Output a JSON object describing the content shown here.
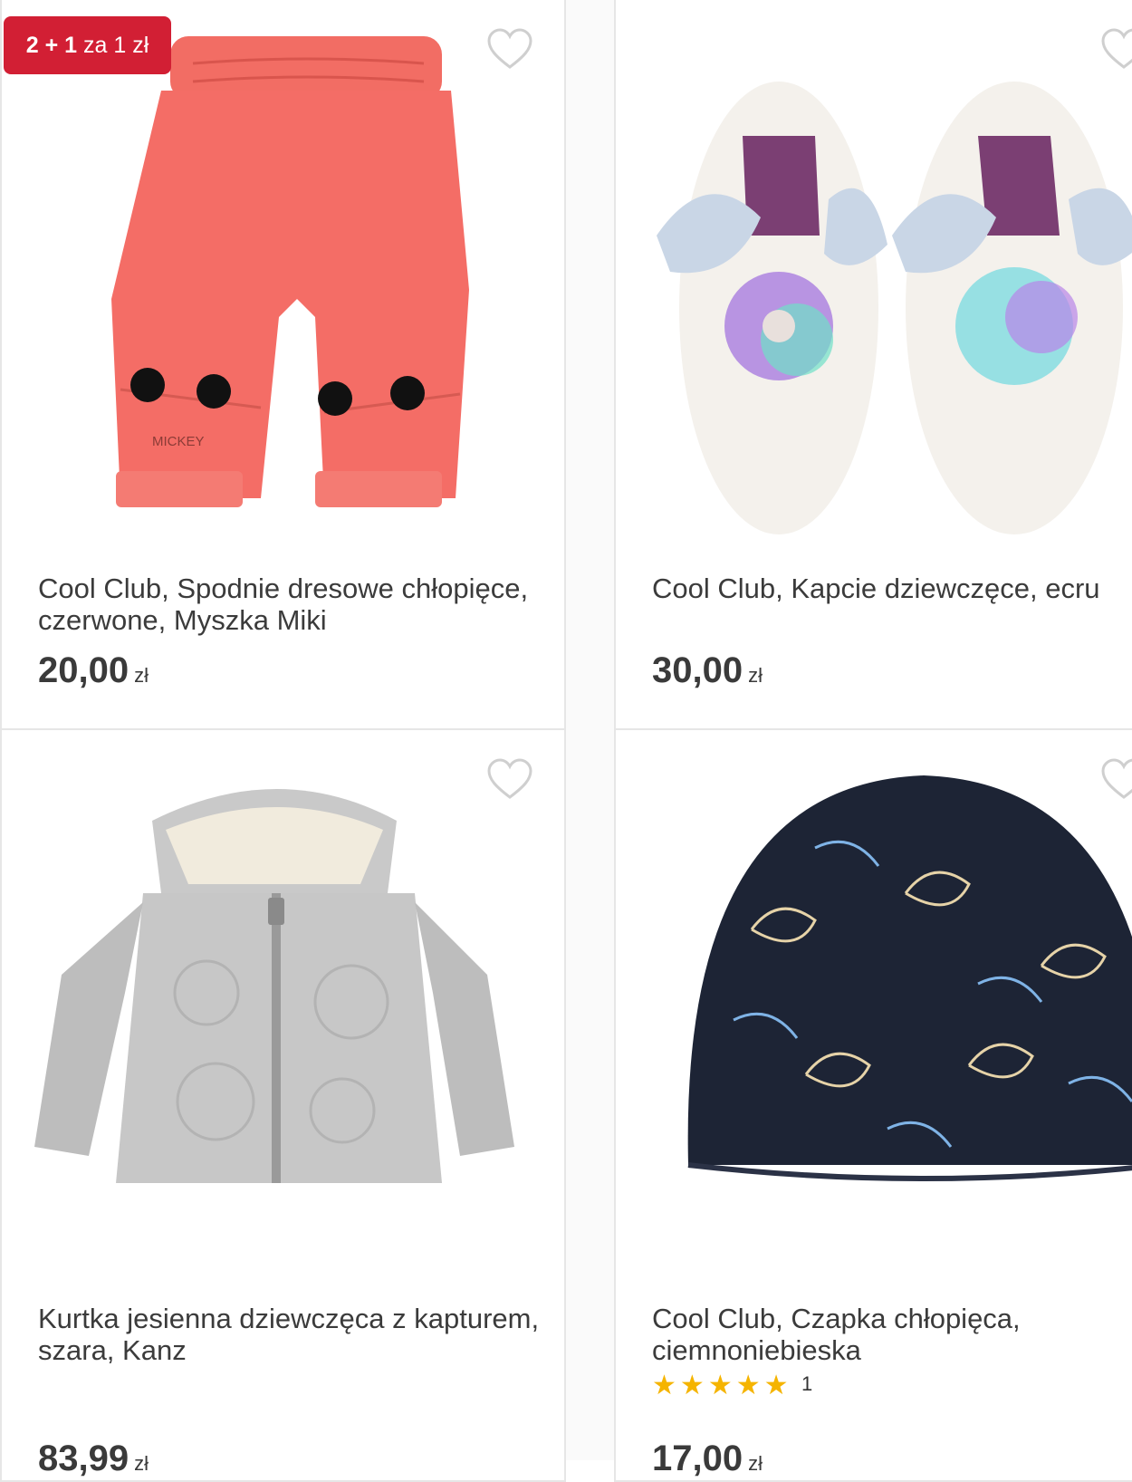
{
  "products": [
    {
      "badge": {
        "main": "2 + 1",
        "rest": "za 1 zł"
      },
      "title": "Cool Club, Spodnie dresowe chłopięce, czerwone, Myszka Miki",
      "price": "20,00",
      "currency": "zł",
      "image_icon": "pants-image",
      "image_text": "MICKEY"
    },
    {
      "title": "Cool Club, Kapcie dziewczęce, ecru",
      "price": "30,00",
      "currency": "zł",
      "image_icon": "slippers-image"
    },
    {
      "title": "Kurtka jesienna dziewczęca z kapturem, szara, Kanz",
      "price": "83,99",
      "currency": "zł",
      "image_icon": "jacket-image"
    },
    {
      "title": "Cool Club, Czapka chłopięca, ciemnoniebieska",
      "rating": 5,
      "review_count": "1",
      "price": "17,00",
      "currency": "zł",
      "image_icon": "beanie-image"
    }
  ],
  "colors": {
    "badge": "#d21f34",
    "star": "#f5b400",
    "heart": "#cfcfcf"
  }
}
